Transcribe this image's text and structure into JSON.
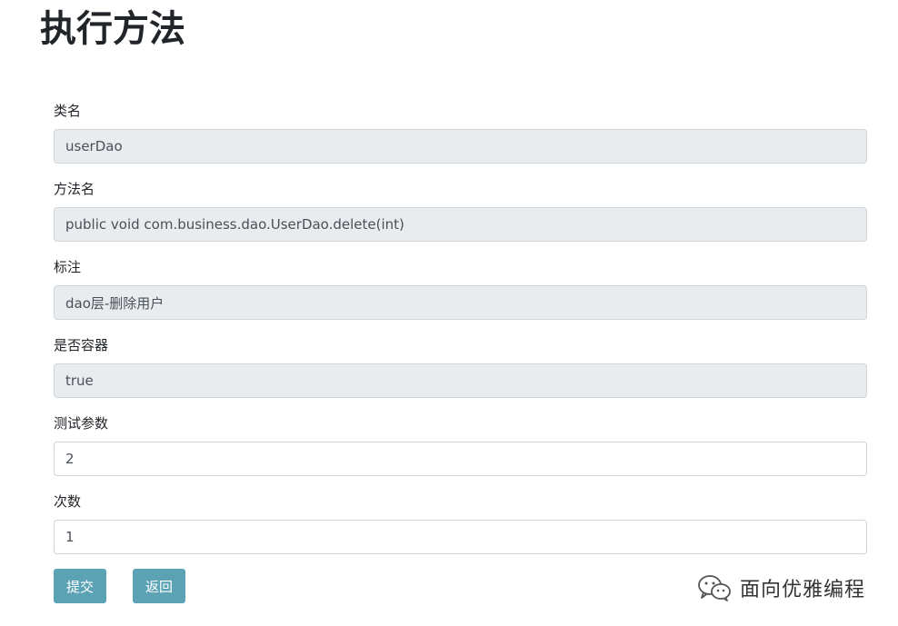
{
  "page": {
    "title": "执行方法"
  },
  "form": {
    "class_name": {
      "label": "类名",
      "value": "userDao",
      "readonly": true
    },
    "method_name": {
      "label": "方法名",
      "value": "public void com.business.dao.UserDao.delete(int)",
      "readonly": true
    },
    "annotation": {
      "label": "标注",
      "value": "dao层-删除用户",
      "readonly": true
    },
    "is_container": {
      "label": "是否容器",
      "value": "true",
      "readonly": true
    },
    "test_params": {
      "label": "测试参数",
      "value": "2",
      "readonly": false
    },
    "count": {
      "label": "次数",
      "value": "1",
      "readonly": false
    }
  },
  "actions": {
    "submit_label": "提交",
    "back_label": "返回",
    "accent_color": "#5aa2b4"
  },
  "watermark": {
    "icon": "wechat-icon",
    "text": "面向优雅编程"
  }
}
